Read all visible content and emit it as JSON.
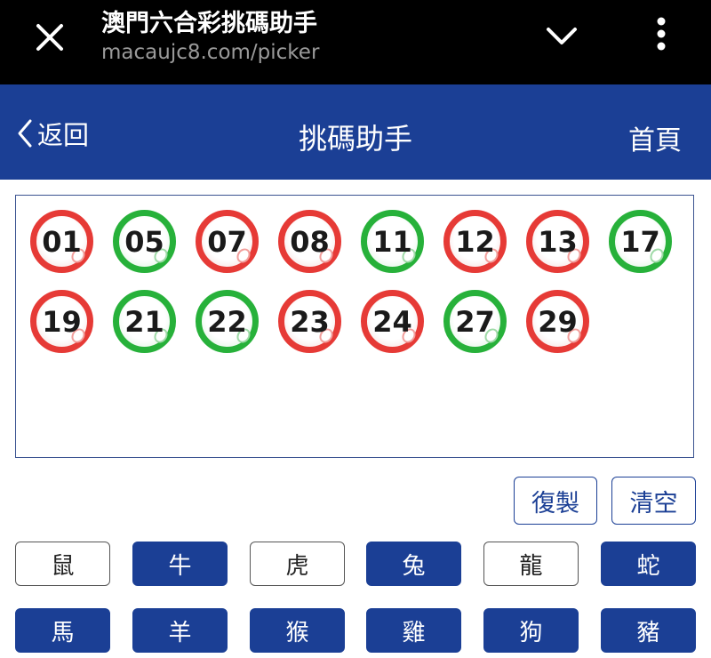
{
  "browser": {
    "title": "澳門六合彩挑碼助手",
    "url": "macaujc8.com/picker"
  },
  "header": {
    "back_label": "返回",
    "title": "挑碼助手",
    "home_label": "首頁",
    "color": "#1b3f95"
  },
  "selected_numbers": [
    {
      "number": "01",
      "color": "red"
    },
    {
      "number": "05",
      "color": "green"
    },
    {
      "number": "07",
      "color": "red"
    },
    {
      "number": "08",
      "color": "red"
    },
    {
      "number": "11",
      "color": "green"
    },
    {
      "number": "12",
      "color": "red"
    },
    {
      "number": "13",
      "color": "red"
    },
    {
      "number": "17",
      "color": "green"
    },
    {
      "number": "19",
      "color": "red"
    },
    {
      "number": "21",
      "color": "green"
    },
    {
      "number": "22",
      "color": "green"
    },
    {
      "number": "23",
      "color": "red"
    },
    {
      "number": "24",
      "color": "red"
    },
    {
      "number": "27",
      "color": "green"
    },
    {
      "number": "29",
      "color": "red"
    }
  ],
  "actions": {
    "copy_label": "復製",
    "clear_label": "清空"
  },
  "zodiac": [
    {
      "label": "鼠",
      "selected": false
    },
    {
      "label": "牛",
      "selected": true
    },
    {
      "label": "虎",
      "selected": false
    },
    {
      "label": "兔",
      "selected": true
    },
    {
      "label": "龍",
      "selected": false
    },
    {
      "label": "蛇",
      "selected": true
    },
    {
      "label": "馬",
      "selected": true
    },
    {
      "label": "羊",
      "selected": true
    },
    {
      "label": "猴",
      "selected": true
    },
    {
      "label": "雞",
      "selected": true
    },
    {
      "label": "狗",
      "selected": true
    },
    {
      "label": "豬",
      "selected": true
    }
  ],
  "colors": {
    "red_ball": "#e63a36",
    "green_ball": "#27b13a",
    "accent": "#1b3f95"
  }
}
